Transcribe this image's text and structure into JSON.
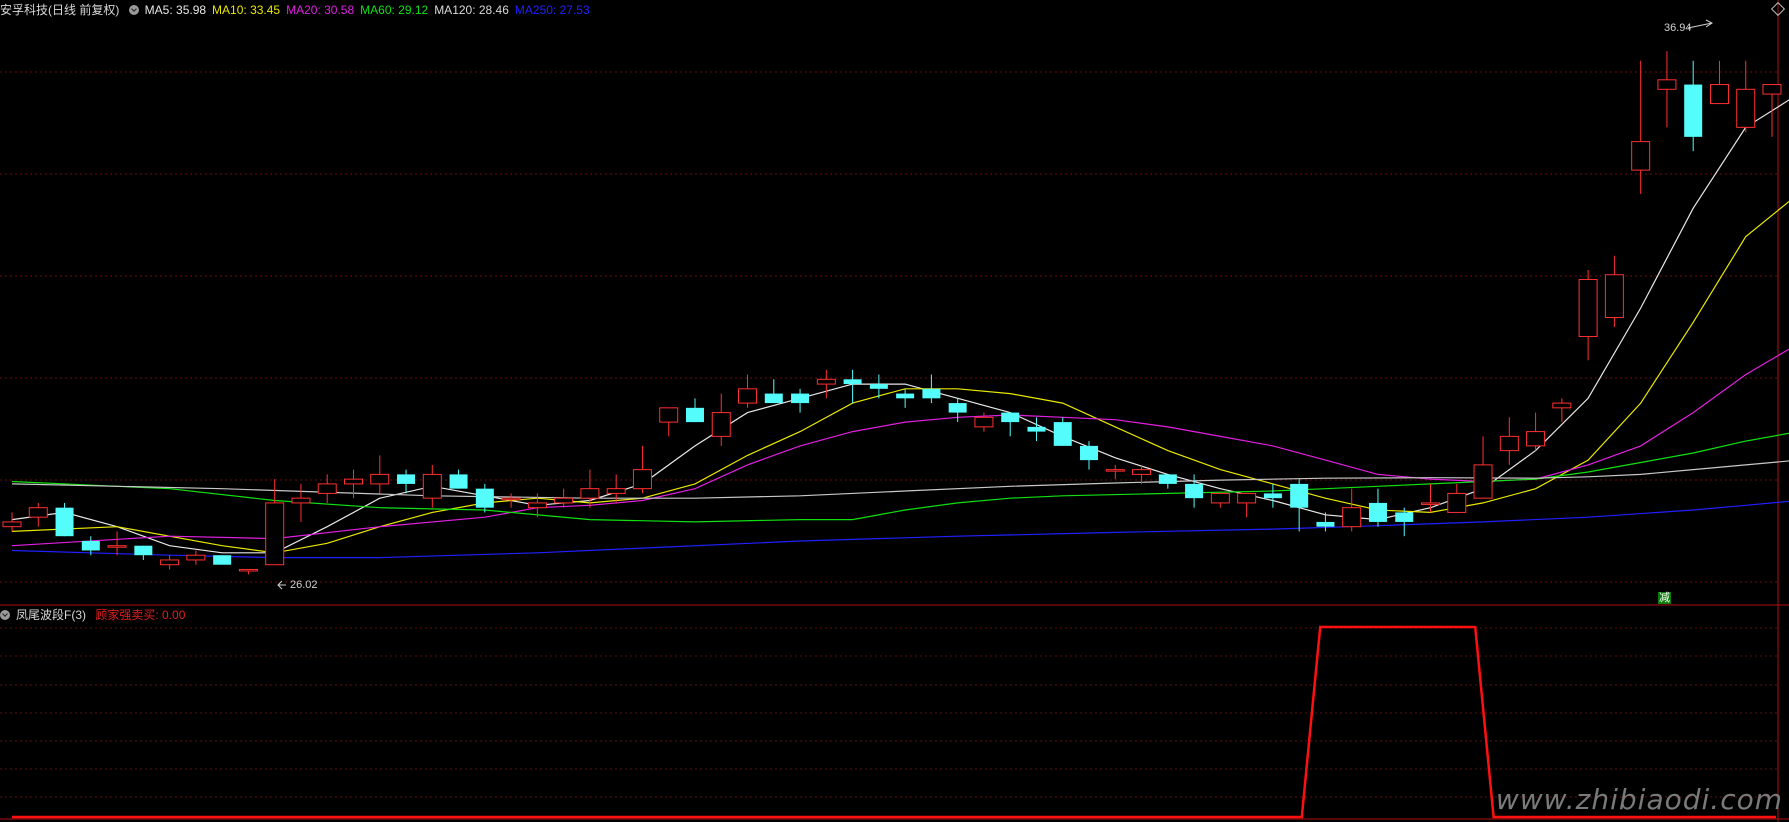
{
  "header": {
    "title": "安孚科技(日线 前复权)",
    "ma": [
      {
        "label": "MA5: 35.98",
        "color": "#e8e8e8"
      },
      {
        "label": "MA10: 33.45",
        "color": "#e8e800"
      },
      {
        "label": "MA20: 30.58",
        "color": "#e020e0"
      },
      {
        "label": "MA60: 29.12",
        "color": "#10e010"
      },
      {
        "label": "MA120: 28.46",
        "color": "#d8d8d8"
      },
      {
        "label": "MA250: 27.53",
        "color": "#2020ff"
      }
    ]
  },
  "annotations": {
    "high_label": "36.94",
    "low_label": "26.02",
    "sell_marker": "减"
  },
  "indicator": {
    "title": "凤尾波段F(3)",
    "label": "顾家强卖买: 0.00",
    "label_color": "#e02020"
  },
  "watermark": "www.zhibiaodi.com",
  "chart_data": [
    {
      "type": "candlestick",
      "title": "安孚科技(日线 前复权)",
      "ylim": [
        25.4,
        37.6
      ],
      "up_color": "#ff3030",
      "down_color": "#54fcfc",
      "candles": [
        [
          26.9,
          27.2,
          27.0,
          26.8
        ],
        [
          27.1,
          27.4,
          27.3,
          26.9
        ],
        [
          27.3,
          27.4,
          26.7,
          26.7
        ],
        [
          26.6,
          26.7,
          26.4,
          26.3
        ],
        [
          26.5,
          26.8,
          26.5,
          26.3
        ],
        [
          26.5,
          26.5,
          26.3,
          26.2
        ],
        [
          26.1,
          26.3,
          26.2,
          26.0
        ],
        [
          26.2,
          26.4,
          26.3,
          26.1
        ],
        [
          26.3,
          26.3,
          26.1,
          26.1
        ],
        [
          26.0,
          26.0,
          26.0,
          25.9
        ],
        [
          26.1,
          27.9,
          27.4,
          26.1
        ],
        [
          27.4,
          27.8,
          27.5,
          27.0
        ],
        [
          27.6,
          28.0,
          27.8,
          27.4
        ],
        [
          27.8,
          28.1,
          27.9,
          27.5
        ],
        [
          27.8,
          28.4,
          28.0,
          27.6
        ],
        [
          28.0,
          28.1,
          27.8,
          27.6
        ],
        [
          27.5,
          28.2,
          28.0,
          27.3
        ],
        [
          28.0,
          28.1,
          27.7,
          27.7
        ],
        [
          27.7,
          27.8,
          27.3,
          27.2
        ],
        [
          27.5,
          27.6,
          27.5,
          27.3
        ],
        [
          27.3,
          27.6,
          27.4,
          27.1
        ],
        [
          27.4,
          27.7,
          27.5,
          27.3
        ],
        [
          27.5,
          28.1,
          27.7,
          27.3
        ],
        [
          27.6,
          28.0,
          27.7,
          27.4
        ],
        [
          27.7,
          28.6,
          28.1,
          27.6
        ],
        [
          29.1,
          29.3,
          29.4,
          28.8
        ],
        [
          29.4,
          29.6,
          29.1,
          29.1
        ],
        [
          28.8,
          29.7,
          29.3,
          28.6
        ],
        [
          29.5,
          30.1,
          29.8,
          29.4
        ],
        [
          29.7,
          30.0,
          29.5,
          29.5
        ],
        [
          29.7,
          29.8,
          29.5,
          29.3
        ],
        [
          29.9,
          30.2,
          30.0,
          29.6
        ],
        [
          30.0,
          30.2,
          29.9,
          29.5
        ],
        [
          29.9,
          30.1,
          29.8,
          29.6
        ],
        [
          29.7,
          29.8,
          29.6,
          29.4
        ],
        [
          29.8,
          30.1,
          29.6,
          29.5
        ],
        [
          29.5,
          29.6,
          29.3,
          29.1
        ],
        [
          29.0,
          29.3,
          29.2,
          28.9
        ],
        [
          29.3,
          29.3,
          29.1,
          28.8
        ],
        [
          29.0,
          29.2,
          28.9,
          28.7
        ],
        [
          29.1,
          29.2,
          28.6,
          28.6
        ],
        [
          28.6,
          28.7,
          28.3,
          28.1
        ],
        [
          28.1,
          28.2,
          28.1,
          27.9
        ],
        [
          28.0,
          28.2,
          28.1,
          27.8
        ],
        [
          28.0,
          28.0,
          27.8,
          27.7
        ],
        [
          27.8,
          28.0,
          27.5,
          27.3
        ],
        [
          27.4,
          27.5,
          27.6,
          27.3
        ],
        [
          27.4,
          27.6,
          27.6,
          27.1
        ],
        [
          27.6,
          27.8,
          27.5,
          27.3
        ],
        [
          27.8,
          27.9,
          27.3,
          26.8
        ],
        [
          27.0,
          27.2,
          26.9,
          26.8
        ],
        [
          26.9,
          27.7,
          27.3,
          26.8
        ],
        [
          27.4,
          27.7,
          27.0,
          26.9
        ],
        [
          27.2,
          27.3,
          27.0,
          26.7
        ],
        [
          27.4,
          27.8,
          27.4,
          27.2
        ],
        [
          27.2,
          27.8,
          27.6,
          27.2
        ],
        [
          27.5,
          28.8,
          28.2,
          27.5
        ],
        [
          28.5,
          29.2,
          28.8,
          28.2
        ],
        [
          28.6,
          29.3,
          28.9,
          28.5
        ],
        [
          29.4,
          29.6,
          29.5,
          29.1
        ],
        [
          30.9,
          32.3,
          32.1,
          30.4
        ],
        [
          31.3,
          32.6,
          32.2,
          31.1
        ],
        [
          34.4,
          36.7,
          35.0,
          33.9
        ],
        [
          36.1,
          36.9,
          36.3,
          35.3
        ],
        [
          36.2,
          36.7,
          35.1,
          34.8
        ],
        [
          35.8,
          36.7,
          36.2,
          35.9
        ],
        [
          35.3,
          36.7,
          36.1,
          35.2
        ],
        [
          36.0,
          36.2,
          36.2,
          35.1
        ]
      ],
      "ma_lines": [
        {
          "name": "MA5",
          "color": "#e8e8e8",
          "points": [
            [
              0,
              27.05
            ],
            [
              2,
              27.2
            ],
            [
              4,
              26.9
            ],
            [
              6,
              26.5
            ],
            [
              8,
              26.35
            ],
            [
              10,
              26.35
            ],
            [
              12,
              26.9
            ],
            [
              14,
              27.5
            ],
            [
              16,
              27.75
            ],
            [
              18,
              27.55
            ],
            [
              20,
              27.35
            ],
            [
              22,
              27.45
            ],
            [
              24,
              27.8
            ],
            [
              26,
              28.6
            ],
            [
              28,
              29.3
            ],
            [
              30,
              29.6
            ],
            [
              32,
              29.9
            ],
            [
              34,
              29.9
            ],
            [
              36,
              29.6
            ],
            [
              38,
              29.3
            ],
            [
              40,
              28.8
            ],
            [
              42,
              28.35
            ],
            [
              44,
              28.0
            ],
            [
              46,
              27.7
            ],
            [
              48,
              27.45
            ],
            [
              50,
              27.15
            ],
            [
              52,
              27.05
            ],
            [
              54,
              27.3
            ],
            [
              56,
              27.7
            ],
            [
              58,
              28.5
            ],
            [
              60,
              29.6
            ],
            [
              62,
              31.5
            ],
            [
              64,
              33.6
            ],
            [
              66,
              35.3
            ],
            [
              68,
              36.0
            ]
          ]
        },
        {
          "name": "MA10",
          "color": "#e8e800",
          "points": [
            [
              0,
              26.8
            ],
            [
              4,
              26.9
            ],
            [
              8,
              26.5
            ],
            [
              10,
              26.35
            ],
            [
              12,
              26.55
            ],
            [
              14,
              26.9
            ],
            [
              16,
              27.2
            ],
            [
              18,
              27.4
            ],
            [
              20,
              27.5
            ],
            [
              22,
              27.4
            ],
            [
              24,
              27.5
            ],
            [
              26,
              27.8
            ],
            [
              28,
              28.4
            ],
            [
              30,
              28.9
            ],
            [
              32,
              29.5
            ],
            [
              34,
              29.8
            ],
            [
              36,
              29.8
            ],
            [
              38,
              29.7
            ],
            [
              40,
              29.5
            ],
            [
              42,
              29.0
            ],
            [
              44,
              28.5
            ],
            [
              46,
              28.1
            ],
            [
              48,
              27.8
            ],
            [
              50,
              27.5
            ],
            [
              52,
              27.25
            ],
            [
              54,
              27.2
            ],
            [
              56,
              27.4
            ],
            [
              58,
              27.7
            ],
            [
              60,
              28.3
            ],
            [
              62,
              29.5
            ],
            [
              64,
              31.2
            ],
            [
              66,
              33.0
            ],
            [
              68,
              33.9
            ]
          ]
        },
        {
          "name": "MA20",
          "color": "#e020e0",
          "points": [
            [
              0,
              26.5
            ],
            [
              6,
              26.7
            ],
            [
              10,
              26.65
            ],
            [
              14,
              26.9
            ],
            [
              18,
              27.1
            ],
            [
              20,
              27.3
            ],
            [
              22,
              27.35
            ],
            [
              24,
              27.45
            ],
            [
              26,
              27.7
            ],
            [
              28,
              28.2
            ],
            [
              30,
              28.6
            ],
            [
              32,
              28.9
            ],
            [
              34,
              29.1
            ],
            [
              36,
              29.2
            ],
            [
              38,
              29.25
            ],
            [
              40,
              29.2
            ],
            [
              42,
              29.15
            ],
            [
              44,
              29.0
            ],
            [
              46,
              28.8
            ],
            [
              48,
              28.6
            ],
            [
              50,
              28.3
            ],
            [
              52,
              28.0
            ],
            [
              54,
              27.9
            ],
            [
              56,
              27.85
            ],
            [
              58,
              27.9
            ],
            [
              60,
              28.2
            ],
            [
              62,
              28.6
            ],
            [
              64,
              29.3
            ],
            [
              66,
              30.1
            ],
            [
              68,
              30.75
            ]
          ]
        },
        {
          "name": "MA60",
          "color": "#10e010",
          "points": [
            [
              0,
              27.85
            ],
            [
              6,
              27.7
            ],
            [
              10,
              27.45
            ],
            [
              14,
              27.3
            ],
            [
              18,
              27.25
            ],
            [
              22,
              27.05
            ],
            [
              26,
              27.0
            ],
            [
              30,
              27.05
            ],
            [
              32,
              27.05
            ],
            [
              34,
              27.25
            ],
            [
              36,
              27.4
            ],
            [
              38,
              27.5
            ],
            [
              40,
              27.55
            ],
            [
              44,
              27.6
            ],
            [
              48,
              27.65
            ],
            [
              50,
              27.7
            ],
            [
              52,
              27.75
            ],
            [
              54,
              27.8
            ],
            [
              56,
              27.85
            ],
            [
              58,
              27.9
            ],
            [
              60,
              28.05
            ],
            [
              62,
              28.25
            ],
            [
              64,
              28.45
            ],
            [
              66,
              28.7
            ],
            [
              68,
              28.9
            ]
          ]
        },
        {
          "name": "MA120",
          "color": "#c8c8c8",
          "points": [
            [
              0,
              27.8
            ],
            [
              8,
              27.7
            ],
            [
              16,
              27.55
            ],
            [
              22,
              27.5
            ],
            [
              26,
              27.5
            ],
            [
              30,
              27.55
            ],
            [
              34,
              27.65
            ],
            [
              38,
              27.75
            ],
            [
              42,
              27.82
            ],
            [
              46,
              27.88
            ],
            [
              50,
              27.92
            ],
            [
              54,
              27.93
            ],
            [
              58,
              27.92
            ],
            [
              60,
              27.95
            ],
            [
              62,
              28.0
            ],
            [
              64,
              28.1
            ],
            [
              66,
              28.2
            ],
            [
              68,
              28.3
            ]
          ]
        },
        {
          "name": "MA250",
          "color": "#2020ff",
          "points": [
            [
              0,
              26.4
            ],
            [
              6,
              26.3
            ],
            [
              10,
              26.25
            ],
            [
              14,
              26.25
            ],
            [
              20,
              26.35
            ],
            [
              24,
              26.45
            ],
            [
              30,
              26.6
            ],
            [
              36,
              26.7
            ],
            [
              42,
              26.78
            ],
            [
              48,
              26.85
            ],
            [
              52,
              26.92
            ],
            [
              56,
              27.0
            ],
            [
              60,
              27.1
            ],
            [
              64,
              27.25
            ],
            [
              66,
              27.35
            ],
            [
              68,
              27.45
            ]
          ]
        }
      ]
    },
    {
      "type": "line",
      "title": "凤尾波段F(3)",
      "ylim": [
        0,
        1
      ],
      "series": [
        {
          "name": "顾家强卖买",
          "color": "#ff1010",
          "x": [
            0,
            49.1,
            49.8,
            55.7,
            56.4,
            68
          ],
          "values": [
            0,
            0,
            1,
            1,
            0,
            0
          ]
        }
      ]
    }
  ]
}
